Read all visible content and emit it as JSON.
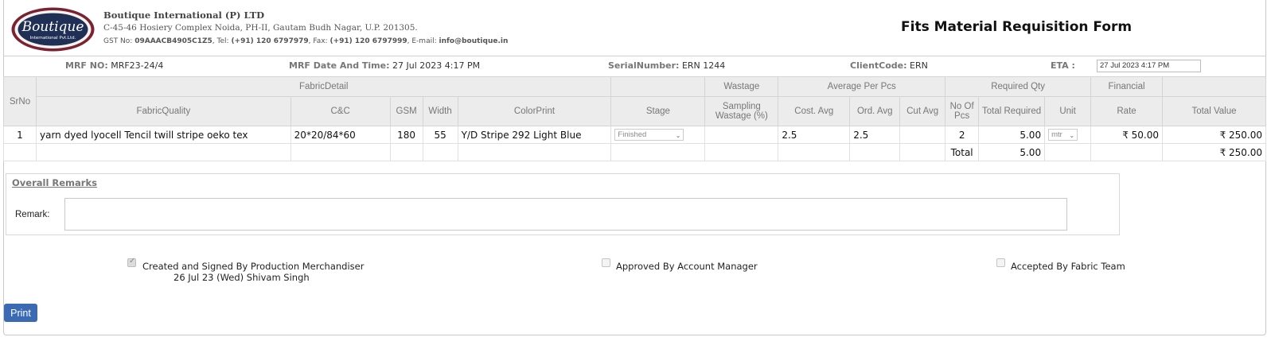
{
  "company": {
    "logo_text": "Boutique",
    "logo_subtext": "International Pvt.Ltd.",
    "name": "Boutique International (P) LTD",
    "address": "C-45-46 Hosiery Complex Noida, PH-II, Gautam Budh Nagar, U.P. 201305.",
    "gst_label": "GST No:",
    "gst_value": "09AAACB4905C1Z5",
    "tel_label": ", Tel:",
    "tel_value": "(+91) 120 6797979",
    "fax_label": ", Fax:",
    "fax_value": "(+91) 120 6797999",
    "email_label": ", E-mail:",
    "email_value": "info@boutique.in"
  },
  "form_title": "Fits Material Requisition Form",
  "info": {
    "mrf_no_label": "MRF NO:",
    "mrf_no": "MRF23-24/4",
    "mrf_date_label": "MRF Date And Time:",
    "mrf_date": "27 Jul 2023 4:17 PM",
    "serial_label": "SerialNumber:",
    "serial": "ERN 1244",
    "client_label": "ClientCode:",
    "client": "ERN",
    "eta_label": "ETA :",
    "eta_value": "27 Jul 2023  4:17 PM"
  },
  "table": {
    "group_headers": {
      "srno": "SrNo",
      "fabric_detail": "FabricDetail",
      "wastage": "Wastage",
      "avg_per_pcs": "Average Per Pcs",
      "required_qty": "Required Qty",
      "financial": "Financial"
    },
    "columns": {
      "fabric_quality": "FabricQuality",
      "cc": "C&C",
      "gsm": "GSM",
      "width": "Width",
      "color_print": "ColorPrint",
      "stage": "Stage",
      "sampling_wastage": "Sampling Wastage (%)",
      "cost_avg": "Cost. Avg",
      "ord_avg": "Ord. Avg",
      "cut_avg": "Cut Avg",
      "no_of_pcs": "No Of Pcs",
      "total_required": "Total Required",
      "unit": "Unit",
      "rate": "Rate",
      "total_value": "Total Value"
    },
    "rows": [
      {
        "srno": "1",
        "fabric_quality": "yarn dyed lyocell Tencil twill stripe oeko tex",
        "cc": "20*20/84*60",
        "gsm": "180",
        "width": "55",
        "color_print": "Y/D Stripe 292 Light Blue",
        "stage": "Finished",
        "sampling_wastage": "",
        "cost_avg": "2.5",
        "ord_avg": "2.5",
        "cut_avg": "",
        "no_of_pcs": "2",
        "total_required": "5.00",
        "unit": "mtr",
        "rate": "₹ 50.00",
        "total_value": "₹ 250.00"
      }
    ],
    "total_row": {
      "label": "Total",
      "total_required": "5.00",
      "total_value": "₹ 250.00"
    }
  },
  "remarks": {
    "title": "Overall Remarks",
    "label": "Remark:",
    "value": ""
  },
  "approvals": {
    "created": {
      "label": "Created and Signed By Production Merchandiser",
      "detail": "26 Jul 23 (Wed) Shivam Singh",
      "checked": true
    },
    "approved": {
      "label": "Approved By Account Manager",
      "checked": false
    },
    "accepted": {
      "label": "Accepted By Fabric Team",
      "checked": false
    }
  },
  "print_label": "Print",
  "colors": {
    "header_bg": "#ececec",
    "print_button": "#3a6ab4",
    "logo_border": "#8b2d3a"
  }
}
